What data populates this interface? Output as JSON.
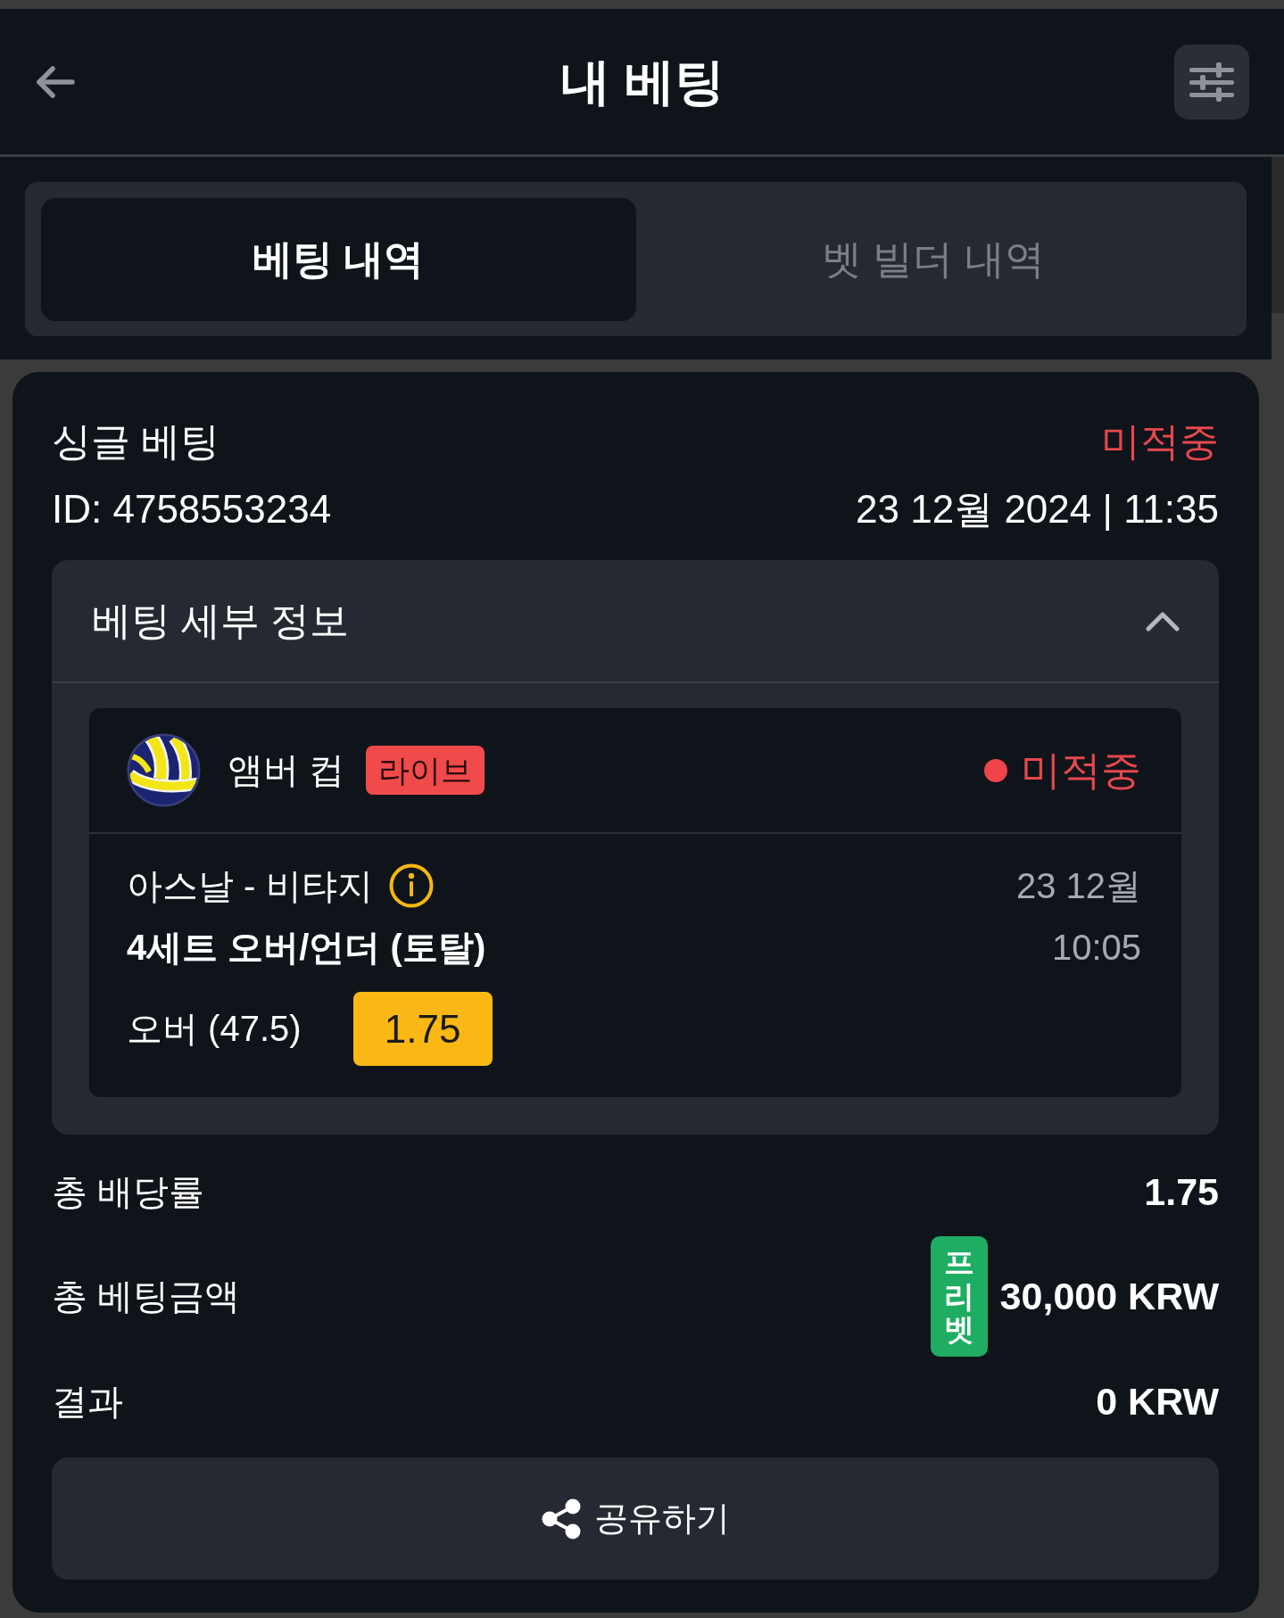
{
  "header": {
    "title": "내 베팅"
  },
  "tabs": [
    {
      "label": "베팅 내역",
      "selected": true
    },
    {
      "label": "벳 빌더 내역",
      "selected": false
    }
  ],
  "bet": {
    "type": "싱글 베팅",
    "status": "미적중",
    "id": "ID: 4758553234",
    "placed_at": "23 12월 2024 | 11:35",
    "details": {
      "title": "베팅 세부 정보",
      "expanded": true,
      "selections": [
        {
          "competition": "앰버 컵",
          "badge": "라이브",
          "status": "미적중",
          "match": "아스날 - 비탸지",
          "date": "23 12월",
          "market": "4세트 오버/언더 (토탈)",
          "time": "10:05",
          "pick": "오버 (47.5)",
          "odds": "1.75"
        }
      ]
    },
    "summary": [
      {
        "label": "총 배당률",
        "value": "1.75"
      },
      {
        "label": "총 베팅금액",
        "badge": "프리벳",
        "value": "30,000 KRW"
      },
      {
        "label": "결과",
        "value": "0 KRW"
      }
    ],
    "share_button": {
      "label": "공유하기"
    }
  }
}
